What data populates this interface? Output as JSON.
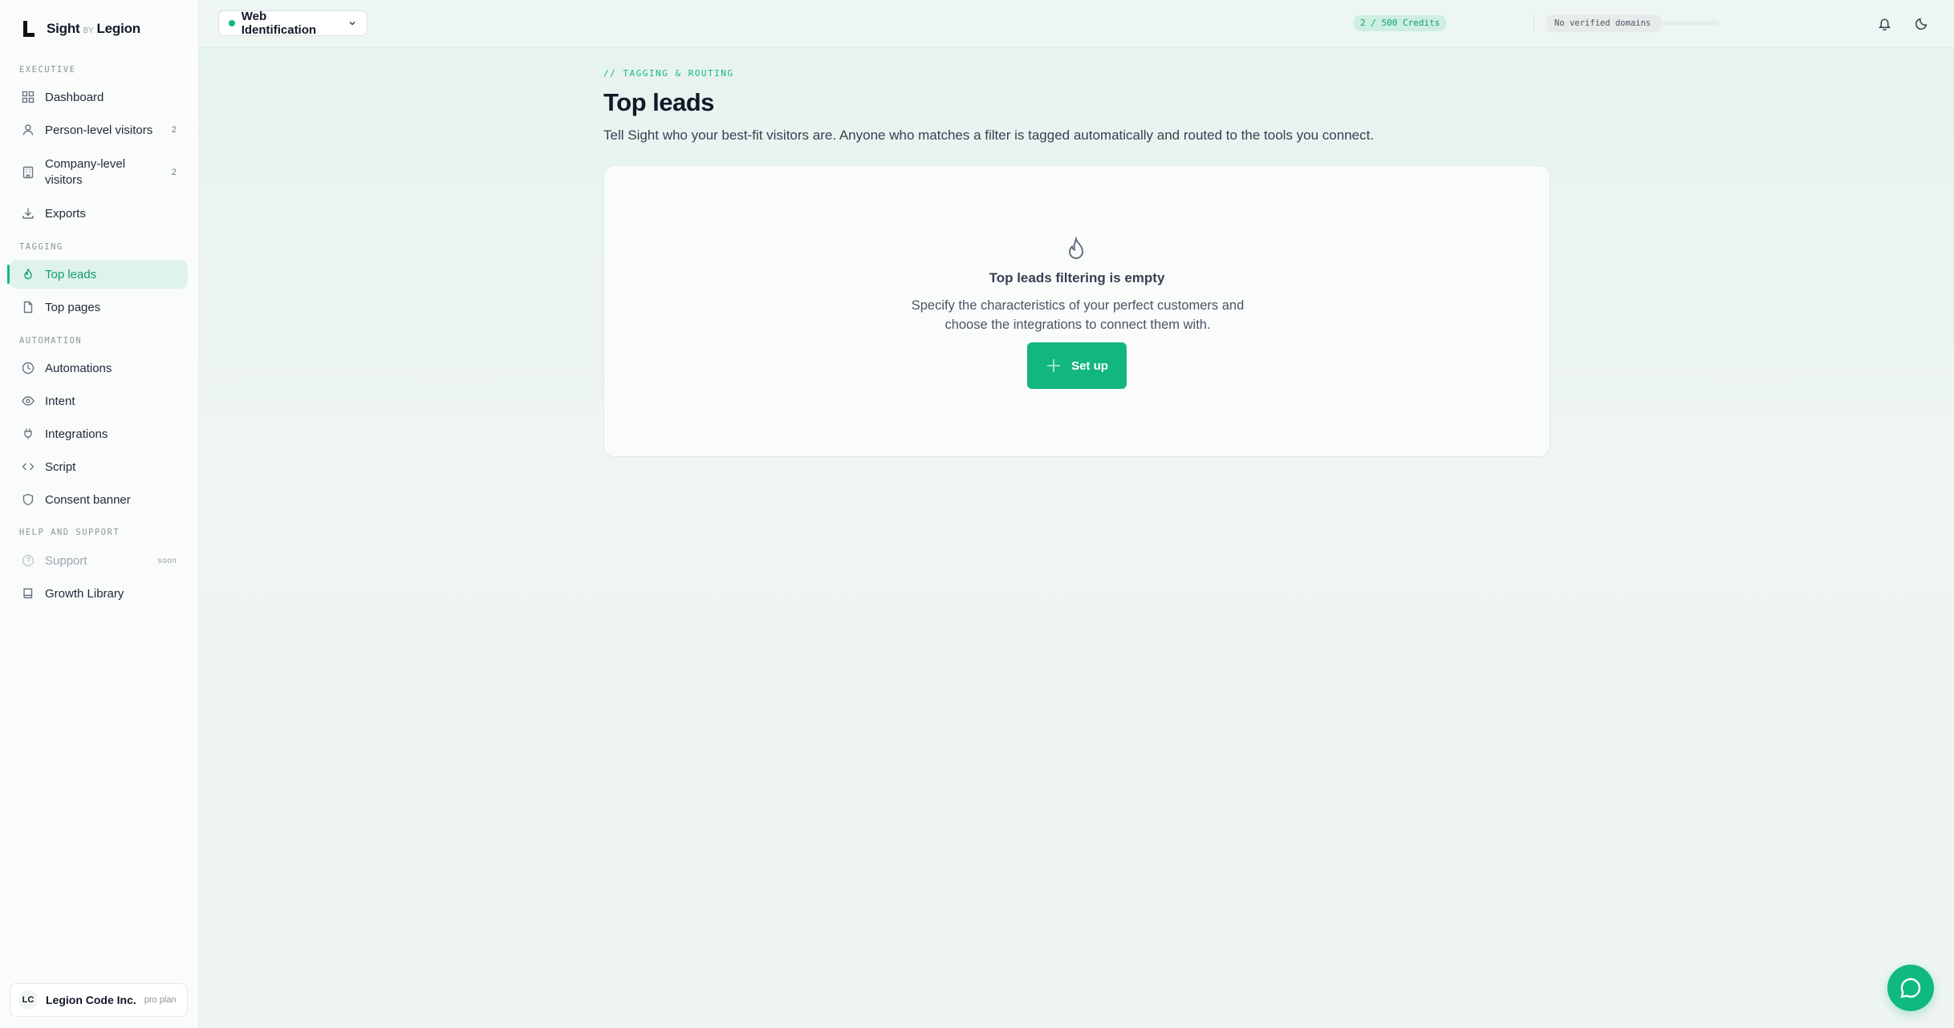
{
  "brand": {
    "name_left": "Sight",
    "name_by": "BY",
    "name_right": "Legion"
  },
  "workspace": {
    "label": "Web Identification"
  },
  "topbar": {
    "credits": "2 / 500 Credits",
    "domains": "No verified domains"
  },
  "sidebar": {
    "sections": {
      "executive": "EXECUTIVE",
      "tagging": "TAGGING",
      "automation": "AUTOMATION",
      "help": "HELP AND SUPPORT"
    },
    "items": [
      {
        "label": "Dashboard"
      },
      {
        "label": "Person-level visitors",
        "count": "2"
      },
      {
        "label": "Company-level visitors",
        "count": "2"
      },
      {
        "label": "Exports"
      },
      {
        "label": "Top leads"
      },
      {
        "label": "Top pages"
      },
      {
        "label": "Automations"
      },
      {
        "label": "Intent"
      },
      {
        "label": "Integrations"
      },
      {
        "label": "Script"
      },
      {
        "label": "Consent banner"
      },
      {
        "label": "Support",
        "badge": "soon"
      },
      {
        "label": "Growth Library"
      }
    ],
    "org": {
      "initials": "LC",
      "name": "Legion Code Inc.",
      "plan": "pro plan"
    }
  },
  "main": {
    "eyebrow": "// TAGGING & ROUTING",
    "title": "Top leads",
    "description": "Tell Sight who your best-fit visitors are. Anyone who matches a filter is tagged automatically and routed to the tools you connect.",
    "empty": {
      "title": "Top leads filtering is empty",
      "description": "Specify the characteristics of your perfect customers and choose the integrations to connect them with.",
      "button": "Set up"
    }
  },
  "colors": {
    "accent": "#10b981",
    "accent_dark": "#0f9f6e",
    "active_bg": "#e0f2ec"
  }
}
